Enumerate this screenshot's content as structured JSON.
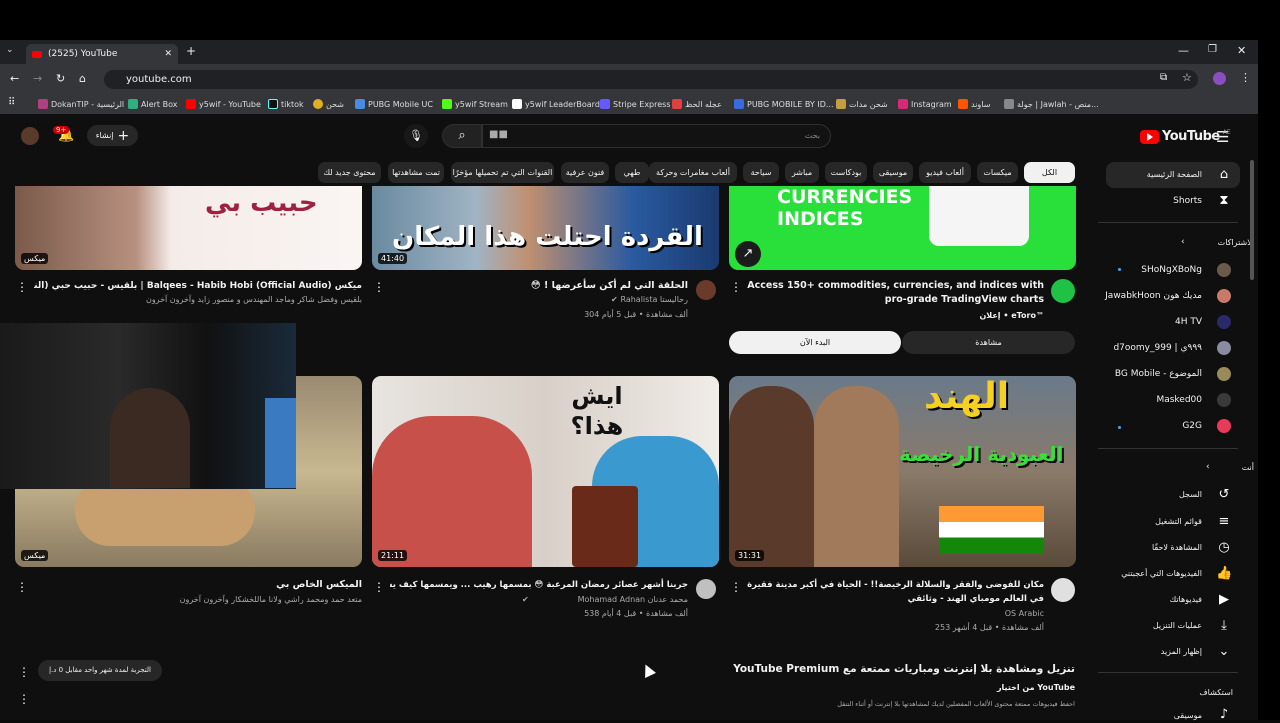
{
  "browser": {
    "tab_title": "(2525) YouTube",
    "url": "youtube.com"
  },
  "bookmarks": [
    "DokanTIP - الرئيسية",
    "Alert Box",
    "y5wif - YouTube",
    "tiktok",
    "شحن",
    "PUBG Mobile UC",
    "y5wif Stream",
    "y5wif LeaderBoard",
    "Stripe Express",
    "عجله الحظ",
    "PUBG MOBILE BY ID...",
    "شحن مدات",
    "Instagram",
    "ساوند",
    "جولة | Jawlah - منص..."
  ],
  "header": {
    "logo": "YouTube",
    "logo_sup": "AE",
    "search_placeholder": "بحث",
    "search_value": "■■",
    "create_label": "إنشاء",
    "notif_count": "9+"
  },
  "chips": [
    "الكل",
    "ميكسات",
    "ألعاب فيديو",
    "موسيقى",
    "بودكاست",
    "مباشر",
    "سياحة",
    "ألعاب مغامرات وحركة",
    "فنون عرفية",
    "طهي",
    "القنوات التي تم تحميلها مؤخرًا",
    "تمت مشاهدتها",
    "محتوى جديد لك"
  ],
  "sidebar": {
    "home": "الصفحة الرئيسية",
    "shorts": "Shorts",
    "subs_title": "الاشتراكات",
    "subs": [
      "SHoNgXBoNg",
      "JawabkHoon مدیك هون",
      "4H TV",
      "d7oomy_999 | ٩٩٩ي",
      "BG Mobile - الموضوع",
      "Masked00",
      "G2G"
    ],
    "you_title": "أنت",
    "you_items": [
      "السجل",
      "قوائم التشغيل",
      "المشاهدة لاحقًا",
      "الفيديوهات التي أعجبتني",
      "فيديوهاتك",
      "عمليات التنزيل",
      "إظهار المزيد"
    ],
    "explore": "استكشاف",
    "music": "موسيقى"
  },
  "row1": [
    {
      "overlay": "حبيب بي",
      "duration": "ميكس",
      "title": "ميكس Balqees - Habib Hobi (Official Audio) | بلقيس - حبيب حبي (النسخة الأصلية)",
      "meta": "بلقيس وفضل شاكر وماجد المهندس و منصور زايد وآخرون آخرون"
    },
    {
      "overlay": "القردة احتلت هذا المكان",
      "duration": "41:40",
      "title": "الحلقة التي لم أكن سأعرضها ! 😳",
      "channel": "Rahalista رحالیستا",
      "meta": "304 ألف مشاهدة • قبل 5 أيام"
    },
    {
      "overlay": "CURRENCIES INDICES",
      "title": "Access 150+ commodities, currencies, and indices with pro-grade TradingView charts",
      "channel": "eToro™",
      "ad": "إعلان",
      "btn_watch": "مشاهدة",
      "btn_start": "البدء الآن"
    }
  ],
  "row2": [
    {
      "duration": "ميكس",
      "title": "الميكس الخاص بي",
      "meta": "متعد حمد ومحمد راشي ولانا ماللخشكار وآخرون آخرون"
    },
    {
      "overlay": "ايش هذا؟",
      "duration": "21:11",
      "title": "جربنا أشهر عصائر رمضان المرعبة 😳 بمسمها رهيب ... ويمسمها كيف يشربونه؟!",
      "channel": "Mohamad Adnan محمد عدنان",
      "meta": "538 ألف مشاهدة • قبل 4 أيام"
    },
    {
      "overlay": "الهند",
      "overlay2": "العبودية الرخيصة",
      "duration": "31:31",
      "title": "مكان للفوضى والفقر والسلالة الرخيصة!! - الحياة في أكبر مدينة فقيرة في العالم مومباي الهند - وثائقي",
      "channel": "OS Arabic",
      "meta": "253 ألف مشاهدة • قبل 4 أشهر"
    }
  ],
  "premium": {
    "title": "تنزيل ومشاهدة بلا إنترنت ومباريات ممتعة مع YouTube Premium",
    "sub": "من اختيار YouTube",
    "desc": "احفظ فيديوهات ممتعة محتوى الألعاب المفضلين لديك لمشاهدتها بلا إنترنت أو أثناء التنقل",
    "trial": "التجربة لمدة شهر واحد مقابل 0 د.إ"
  }
}
